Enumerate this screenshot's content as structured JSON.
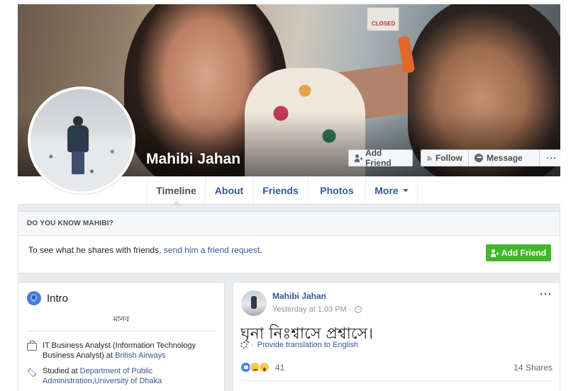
{
  "profile": {
    "name": "Mahibi Jahan"
  },
  "cover_buttons": {
    "add_friend": "Add Friend",
    "follow": "Follow",
    "message": "Message",
    "more": "···"
  },
  "cover_sign": "CLOSED",
  "tabs": [
    {
      "label": "Timeline",
      "active": true
    },
    {
      "label": "About"
    },
    {
      "label": "Friends"
    },
    {
      "label": "Photos"
    },
    {
      "label": "More"
    }
  ],
  "know": {
    "heading": "DO YOU KNOW MAHIBI?",
    "text": "To see what he shares with friends, ",
    "link": "send him a friend request",
    "period": ".",
    "button": "Add Friend"
  },
  "intro": {
    "title": "Intro",
    "bio": "মানব",
    "work_prefix": "IT Business Analyst (Information Technology Business Analyst) at ",
    "work_org": "British Airways",
    "study_prefix": "Studied at ",
    "study_org": "Department of Public Administration,University of Dhaka"
  },
  "post": {
    "author": "Mahibi Jahan",
    "time": "Yesterday at 1:03 PM ·",
    "text": "ঘৃনা নিঃশ্বাসে প্রশ্বাসে।",
    "translate": "Provide translation to English",
    "reaction_count": "41",
    "shares": "14 Shares",
    "more": "···"
  },
  "colors": {
    "link": "#365899",
    "green_button": "#42b72a",
    "page_bg": "#e9ebee"
  }
}
